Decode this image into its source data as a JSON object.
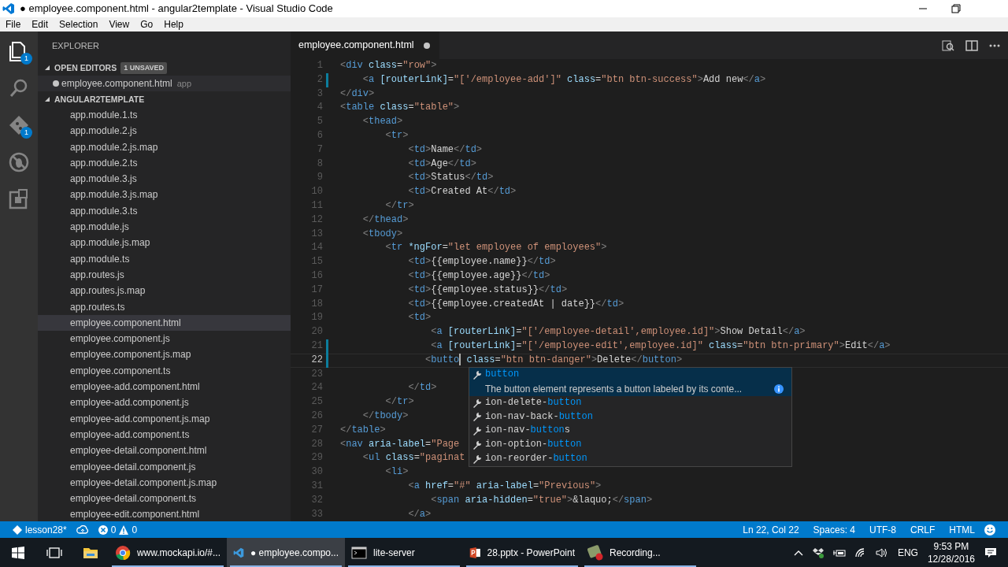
{
  "window": {
    "title": "● employee.component.html - angular2template - Visual Studio Code"
  },
  "menu": [
    "File",
    "Edit",
    "Selection",
    "View",
    "Go",
    "Help"
  ],
  "activity_bar": [
    {
      "kind": "files",
      "selected": true,
      "badge": "1"
    },
    {
      "kind": "search",
      "selected": false
    },
    {
      "kind": "git",
      "selected": false,
      "badge": "1"
    },
    {
      "kind": "debug",
      "selected": false
    },
    {
      "kind": "extensions",
      "selected": false
    }
  ],
  "sidebar": {
    "title": "EXPLORER",
    "open_editors": {
      "label": "OPEN EDITORS",
      "expanded": true,
      "badge": "1 UNSAVED",
      "items": [
        {
          "name": "employee.component.html",
          "folder": "app",
          "dirty": true
        }
      ]
    },
    "project": {
      "label": "ANGULAR2TEMPLATE",
      "expanded": true,
      "files": [
        {
          "name": "app.module.1.ts",
          "selected": false
        },
        {
          "name": "app.module.2.js",
          "selected": false
        },
        {
          "name": "app.module.2.js.map",
          "selected": false
        },
        {
          "name": "app.module.2.ts",
          "selected": false
        },
        {
          "name": "app.module.3.js",
          "selected": false
        },
        {
          "name": "app.module.3.js.map",
          "selected": false
        },
        {
          "name": "app.module.3.ts",
          "selected": false
        },
        {
          "name": "app.module.js",
          "selected": false
        },
        {
          "name": "app.module.js.map",
          "selected": false
        },
        {
          "name": "app.module.ts",
          "selected": false
        },
        {
          "name": "app.routes.js",
          "selected": false
        },
        {
          "name": "app.routes.js.map",
          "selected": false
        },
        {
          "name": "app.routes.ts",
          "selected": false
        },
        {
          "name": "employee.component.html",
          "selected": true
        },
        {
          "name": "employee.component.js",
          "selected": false
        },
        {
          "name": "employee.component.js.map",
          "selected": false
        },
        {
          "name": "employee.component.ts",
          "selected": false
        },
        {
          "name": "employee-add.component.html",
          "selected": false
        },
        {
          "name": "employee-add.component.js",
          "selected": false
        },
        {
          "name": "employee-add.component.js.map",
          "selected": false
        },
        {
          "name": "employee-add.component.ts",
          "selected": false
        },
        {
          "name": "employee-detail.component.html",
          "selected": false
        },
        {
          "name": "employee-detail.component.js",
          "selected": false
        },
        {
          "name": "employee-detail.component.js.map",
          "selected": false
        },
        {
          "name": "employee-detail.component.ts",
          "selected": false
        },
        {
          "name": "employee-edit.component.html",
          "selected": false
        }
      ]
    }
  },
  "tabs": [
    {
      "label": "employee.component.html",
      "selected": true,
      "dirty": true
    }
  ],
  "editor": {
    "lines": [
      {
        "n": "1",
        "modified": false,
        "current": false,
        "text": "<div class=\"row\">"
      },
      {
        "n": "2",
        "modified": true,
        "current": false,
        "text": "    <a [routerLink]=\"['/employee-add']\" class=\"btn btn-success\">Add new</a>"
      },
      {
        "n": "3",
        "modified": false,
        "current": false,
        "text": "</div>"
      },
      {
        "n": "4",
        "modified": false,
        "current": false,
        "text": "<table class=\"table\">"
      },
      {
        "n": "5",
        "modified": false,
        "current": false,
        "text": "    <thead>"
      },
      {
        "n": "6",
        "modified": false,
        "current": false,
        "text": "        <tr>"
      },
      {
        "n": "7",
        "modified": false,
        "current": false,
        "text": "            <td>Name</td>"
      },
      {
        "n": "8",
        "modified": false,
        "current": false,
        "text": "            <td>Age</td>"
      },
      {
        "n": "9",
        "modified": false,
        "current": false,
        "text": "            <td>Status</td>"
      },
      {
        "n": "10",
        "modified": false,
        "current": false,
        "text": "            <td>Created At</td>"
      },
      {
        "n": "11",
        "modified": false,
        "current": false,
        "text": "        </tr>"
      },
      {
        "n": "12",
        "modified": false,
        "current": false,
        "text": "    </thead>"
      },
      {
        "n": "13",
        "modified": false,
        "current": false,
        "text": "    <tbody>"
      },
      {
        "n": "14",
        "modified": false,
        "current": false,
        "text": "        <tr *ngFor=\"let employee of employees\">"
      },
      {
        "n": "15",
        "modified": false,
        "current": false,
        "text": "            <td>{{employee.name}}</td>"
      },
      {
        "n": "16",
        "modified": false,
        "current": false,
        "text": "            <td>{{employee.age}}</td>"
      },
      {
        "n": "17",
        "modified": false,
        "current": false,
        "text": "            <td>{{employee.status}}</td>"
      },
      {
        "n": "18",
        "modified": false,
        "current": false,
        "text": "            <td>{{employee.createdAt | date}}</td>"
      },
      {
        "n": "19",
        "modified": false,
        "current": false,
        "text": "            <td>"
      },
      {
        "n": "20",
        "modified": false,
        "current": false,
        "text": "                <a [routerLink]=\"['/employee-detail',employee.id]\">Show Detail</a>"
      },
      {
        "n": "21",
        "modified": true,
        "current": false,
        "text": "                <a [routerLink]=\"['/employee-edit',employee.id]\" class=\"btn btn-primary\">Edit</a>"
      },
      {
        "n": "22",
        "modified": true,
        "current": true,
        "text": "               <butto",
        "text_after_caret": " class=\"btn btn-danger\">Delete</button>"
      },
      {
        "n": "23",
        "modified": false,
        "current": false
      },
      {
        "n": "24",
        "modified": false,
        "current": false,
        "text": "            </td>"
      },
      {
        "n": "25",
        "modified": false,
        "current": false,
        "text": "        </tr>"
      },
      {
        "n": "26",
        "modified": false,
        "current": false,
        "text": "    </tbody>"
      },
      {
        "n": "27",
        "modified": false,
        "current": false,
        "text": "</table>"
      },
      {
        "n": "28",
        "modified": false,
        "current": false,
        "text": "<nav aria-label=\"Page"
      },
      {
        "n": "29",
        "modified": false,
        "current": false,
        "text": "    <ul class=\"paginat"
      },
      {
        "n": "30",
        "modified": false,
        "current": false,
        "text": "        <li>"
      },
      {
        "n": "31",
        "modified": false,
        "current": false,
        "text": "            <a href=\"#\" aria-label=\"Previous\">"
      },
      {
        "n": "32",
        "modified": false,
        "current": false,
        "text": "                <span aria-hidden=\"true\">&laquo;</span>"
      },
      {
        "n": "33",
        "modified": false,
        "current": false,
        "text": "            </a>"
      }
    ],
    "suggestions": [
      {
        "selected": true,
        "parts": [
          {
            "s": "button",
            "hit": true
          }
        ],
        "description": "The button element represents a button labeled by its conte..."
      },
      {
        "selected": false,
        "parts": [
          {
            "s": "ion-delete-",
            "hit": false
          },
          {
            "s": "button",
            "hit": true
          }
        ]
      },
      {
        "selected": false,
        "parts": [
          {
            "s": "ion-nav-back-",
            "hit": false
          },
          {
            "s": "button",
            "hit": true
          }
        ]
      },
      {
        "selected": false,
        "parts": [
          {
            "s": "ion-nav-",
            "hit": false
          },
          {
            "s": "button",
            "hit": true
          },
          {
            "s": "s",
            "hit": false
          }
        ]
      },
      {
        "selected": false,
        "parts": [
          {
            "s": "ion-option-",
            "hit": false
          },
          {
            "s": "button",
            "hit": true
          }
        ]
      },
      {
        "selected": false,
        "parts": [
          {
            "s": "ion-reorder-",
            "hit": false
          },
          {
            "s": "button",
            "hit": true
          }
        ]
      }
    ]
  },
  "status_bar": {
    "branch": "lesson28*",
    "errors": "0",
    "warnings": "0",
    "right": [
      "Ln 22, Col 22",
      "Spaces: 4",
      "UTF-8",
      "CRLF",
      "HTML"
    ]
  },
  "taskbar": {
    "apps": [
      {
        "kind": "explorer",
        "selected": false,
        "running": false
      },
      {
        "kind": "chrome",
        "label": "www.mockapi.io/#...",
        "selected": false,
        "running": true
      },
      {
        "kind": "vscode",
        "label": "● employee.compo...",
        "selected": true,
        "running": true
      },
      {
        "kind": "terminal",
        "label": "lite-server",
        "selected": false,
        "running": true
      },
      {
        "kind": "powerpoint",
        "label": "28.pptx - PowerPoint",
        "selected": false,
        "running": true
      },
      {
        "kind": "recorder",
        "label": "Recording...",
        "selected": false,
        "running": true
      }
    ],
    "language": "ENG",
    "time": "9:53 PM",
    "date": "12/28/2016"
  }
}
